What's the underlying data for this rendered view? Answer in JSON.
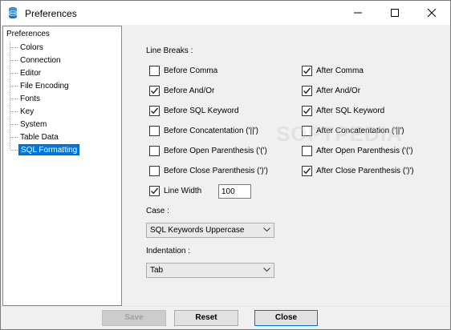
{
  "window": {
    "title": "Preferences",
    "icon": "database-icon"
  },
  "tree": {
    "root": "Preferences",
    "items": [
      {
        "label": "Colors"
      },
      {
        "label": "Connection"
      },
      {
        "label": "Editor"
      },
      {
        "label": "File Encoding"
      },
      {
        "label": "Fonts"
      },
      {
        "label": "Key"
      },
      {
        "label": "System"
      },
      {
        "label": "Table Data"
      },
      {
        "label": "SQL Formatting",
        "selected": true
      }
    ]
  },
  "line_breaks": {
    "heading": "Line Breaks :",
    "before_comma": {
      "label": "Before Comma",
      "checked": false
    },
    "after_comma": {
      "label": "After Comma",
      "checked": true
    },
    "before_and_or": {
      "label": "Before And/Or",
      "checked": true
    },
    "after_and_or": {
      "label": "After And/Or",
      "checked": true
    },
    "before_sql_keyword": {
      "label": "Before SQL Keyword",
      "checked": true
    },
    "after_sql_keyword": {
      "label": "After SQL Keyword",
      "checked": true
    },
    "before_concatenation": {
      "label": "Before Concatentation ('||')",
      "checked": false
    },
    "after_concatenation": {
      "label": "After Concatentation ('||')",
      "checked": false
    },
    "before_open_paren": {
      "label": "Before Open Parenthesis ('(')",
      "checked": false
    },
    "after_open_paren": {
      "label": "After Open Parenthesis ('(')",
      "checked": false
    },
    "before_close_paren": {
      "label": "Before Close Parenthesis (')')",
      "checked": false
    },
    "after_close_paren": {
      "label": "After Close Parenthesis (')')",
      "checked": true
    },
    "line_width": {
      "label": "Line Width",
      "checked": true,
      "value": "100"
    }
  },
  "case": {
    "label": "Case :",
    "selected": "SQL Keywords Uppercase"
  },
  "indentation": {
    "label": "Indentation :",
    "selected": "Tab"
  },
  "buttons": {
    "save": "Save",
    "reset": "Reset",
    "close": "Close"
  },
  "watermark": "SOFTPEDIA",
  "colors": {
    "selection": "#0078d7",
    "dialog_bg": "#f0f0f0"
  }
}
